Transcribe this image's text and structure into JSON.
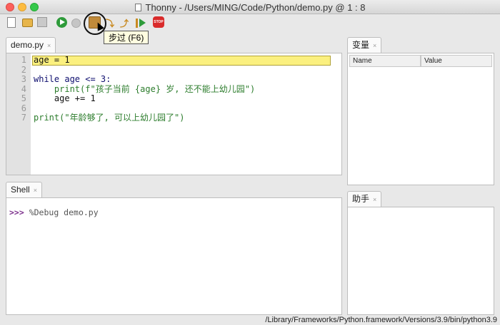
{
  "window": {
    "title": "Thonny  -  /Users/MING/Code/Python/demo.py  @  1 : 8"
  },
  "toolbar": {
    "tooltip": "步过 (F6)",
    "buttons": [
      {
        "icon": "new-file-icon"
      },
      {
        "icon": "open-folder-icon"
      },
      {
        "icon": "save-icon"
      },
      {
        "icon": "run-icon"
      },
      {
        "icon": "debug-bug-icon"
      },
      {
        "icon": "step-over-icon"
      },
      {
        "icon": "step-into-icon"
      },
      {
        "icon": "step-out-icon"
      },
      {
        "icon": "resume-icon"
      },
      {
        "icon": "stop-icon",
        "label": "STOP"
      }
    ]
  },
  "editor": {
    "tab_label": "demo.py",
    "tab_close": "×",
    "current_line": 1,
    "lines": [
      {
        "no": "1",
        "text": "age = 1"
      },
      {
        "no": "2",
        "text": ""
      },
      {
        "no": "3",
        "text": "while age <= 3:"
      },
      {
        "no": "4",
        "text": "    print(f\"孩子当前 {age} 岁, 还不能上幼儿园\")"
      },
      {
        "no": "5",
        "text": "    age += 1"
      },
      {
        "no": "6",
        "text": ""
      },
      {
        "no": "7",
        "text": "print(\"年龄够了, 可以上幼儿园了\")"
      }
    ]
  },
  "variables": {
    "tab_label": "变量",
    "tab_close": "×",
    "columns": [
      "Name",
      "Value"
    ]
  },
  "shell": {
    "tab_label": "Shell",
    "tab_close": "×",
    "prompt": ">>>",
    "command": " %Debug demo.py"
  },
  "assistant": {
    "tab_label": "助手",
    "tab_close": "×"
  },
  "statusbar": {
    "interpreter": "/Library/Frameworks/Python.framework/Versions/3.9/bin/python3.9"
  },
  "colors": {
    "highlight": "#fbf07f",
    "keyword": "#0f0f6f",
    "string": "#2d7d2d",
    "prompt": "#7a2c8a"
  }
}
